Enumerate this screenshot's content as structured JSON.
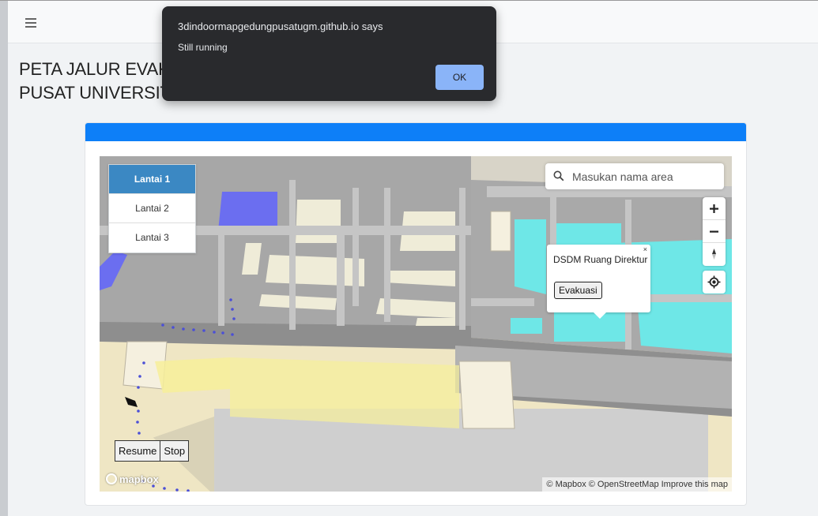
{
  "topbar": {
    "menu_icon": "hamburger-icon"
  },
  "page": {
    "title_line1": "PETA JALUR EVAKUASI GEDUNG",
    "title_line2": "PUSAT UNIVERSITAS GADJAH MADA"
  },
  "map": {
    "floors": [
      {
        "label": "Lantai 1",
        "active": true
      },
      {
        "label": "Lantai 2",
        "active": false
      },
      {
        "label": "Lantai 3",
        "active": false
      }
    ],
    "search": {
      "placeholder": "Masukan nama area",
      "icon": "search-icon"
    },
    "controls": {
      "zoom_in_icon": "plus-icon",
      "zoom_out_icon": "minus-icon",
      "compass_icon": "compass-icon",
      "geolocate_icon": "geolocate-icon"
    },
    "popup": {
      "close": "×",
      "title": "DSDM Ruang Direktur",
      "button": "Evakuasi"
    },
    "simulation": {
      "resume": "Resume",
      "stop": "Stop"
    },
    "logo": "mapbox",
    "attribution": "© Mapbox © OpenStreetMap Improve this map"
  },
  "dialog": {
    "title": "3dindoormapgedungpusatugm.github.io says",
    "message": "Still running",
    "ok": "OK"
  },
  "colors": {
    "header_blue": "#0d7ff8",
    "active_floor": "#3b88c3",
    "room_cyan": "#6ee7e7",
    "room_blue": "#6b6ef0",
    "route_dots": "#4b4fd6",
    "dialog_bg": "#292a2d",
    "ok_button": "#8ab4f8"
  }
}
